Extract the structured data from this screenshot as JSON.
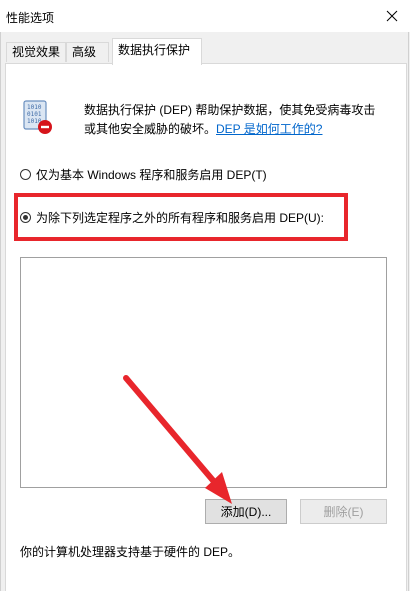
{
  "window": {
    "title": "性能选项"
  },
  "tabs": [
    {
      "label": "视觉效果"
    },
    {
      "label": "高级"
    },
    {
      "label": "数据执行保护"
    }
  ],
  "dep": {
    "description": "数据执行保护 (DEP) 帮助保护数据，使其免受病毒攻击或其他安全威胁的破坏。",
    "link": "DEP 是如何工作的?",
    "option1": "仅为基本 Windows 程序和服务启用 DEP(T)",
    "option2": "为除下列选定程序之外的所有程序和服务启用 DEP(U):",
    "selected_option": 2,
    "add_button": "添加(D)...",
    "remove_button": "删除(E)",
    "hardware_note": "你的计算机处理器支持基于硬件的 DEP。"
  },
  "colors": {
    "highlight": "#e8262c",
    "link": "#0066cc"
  }
}
